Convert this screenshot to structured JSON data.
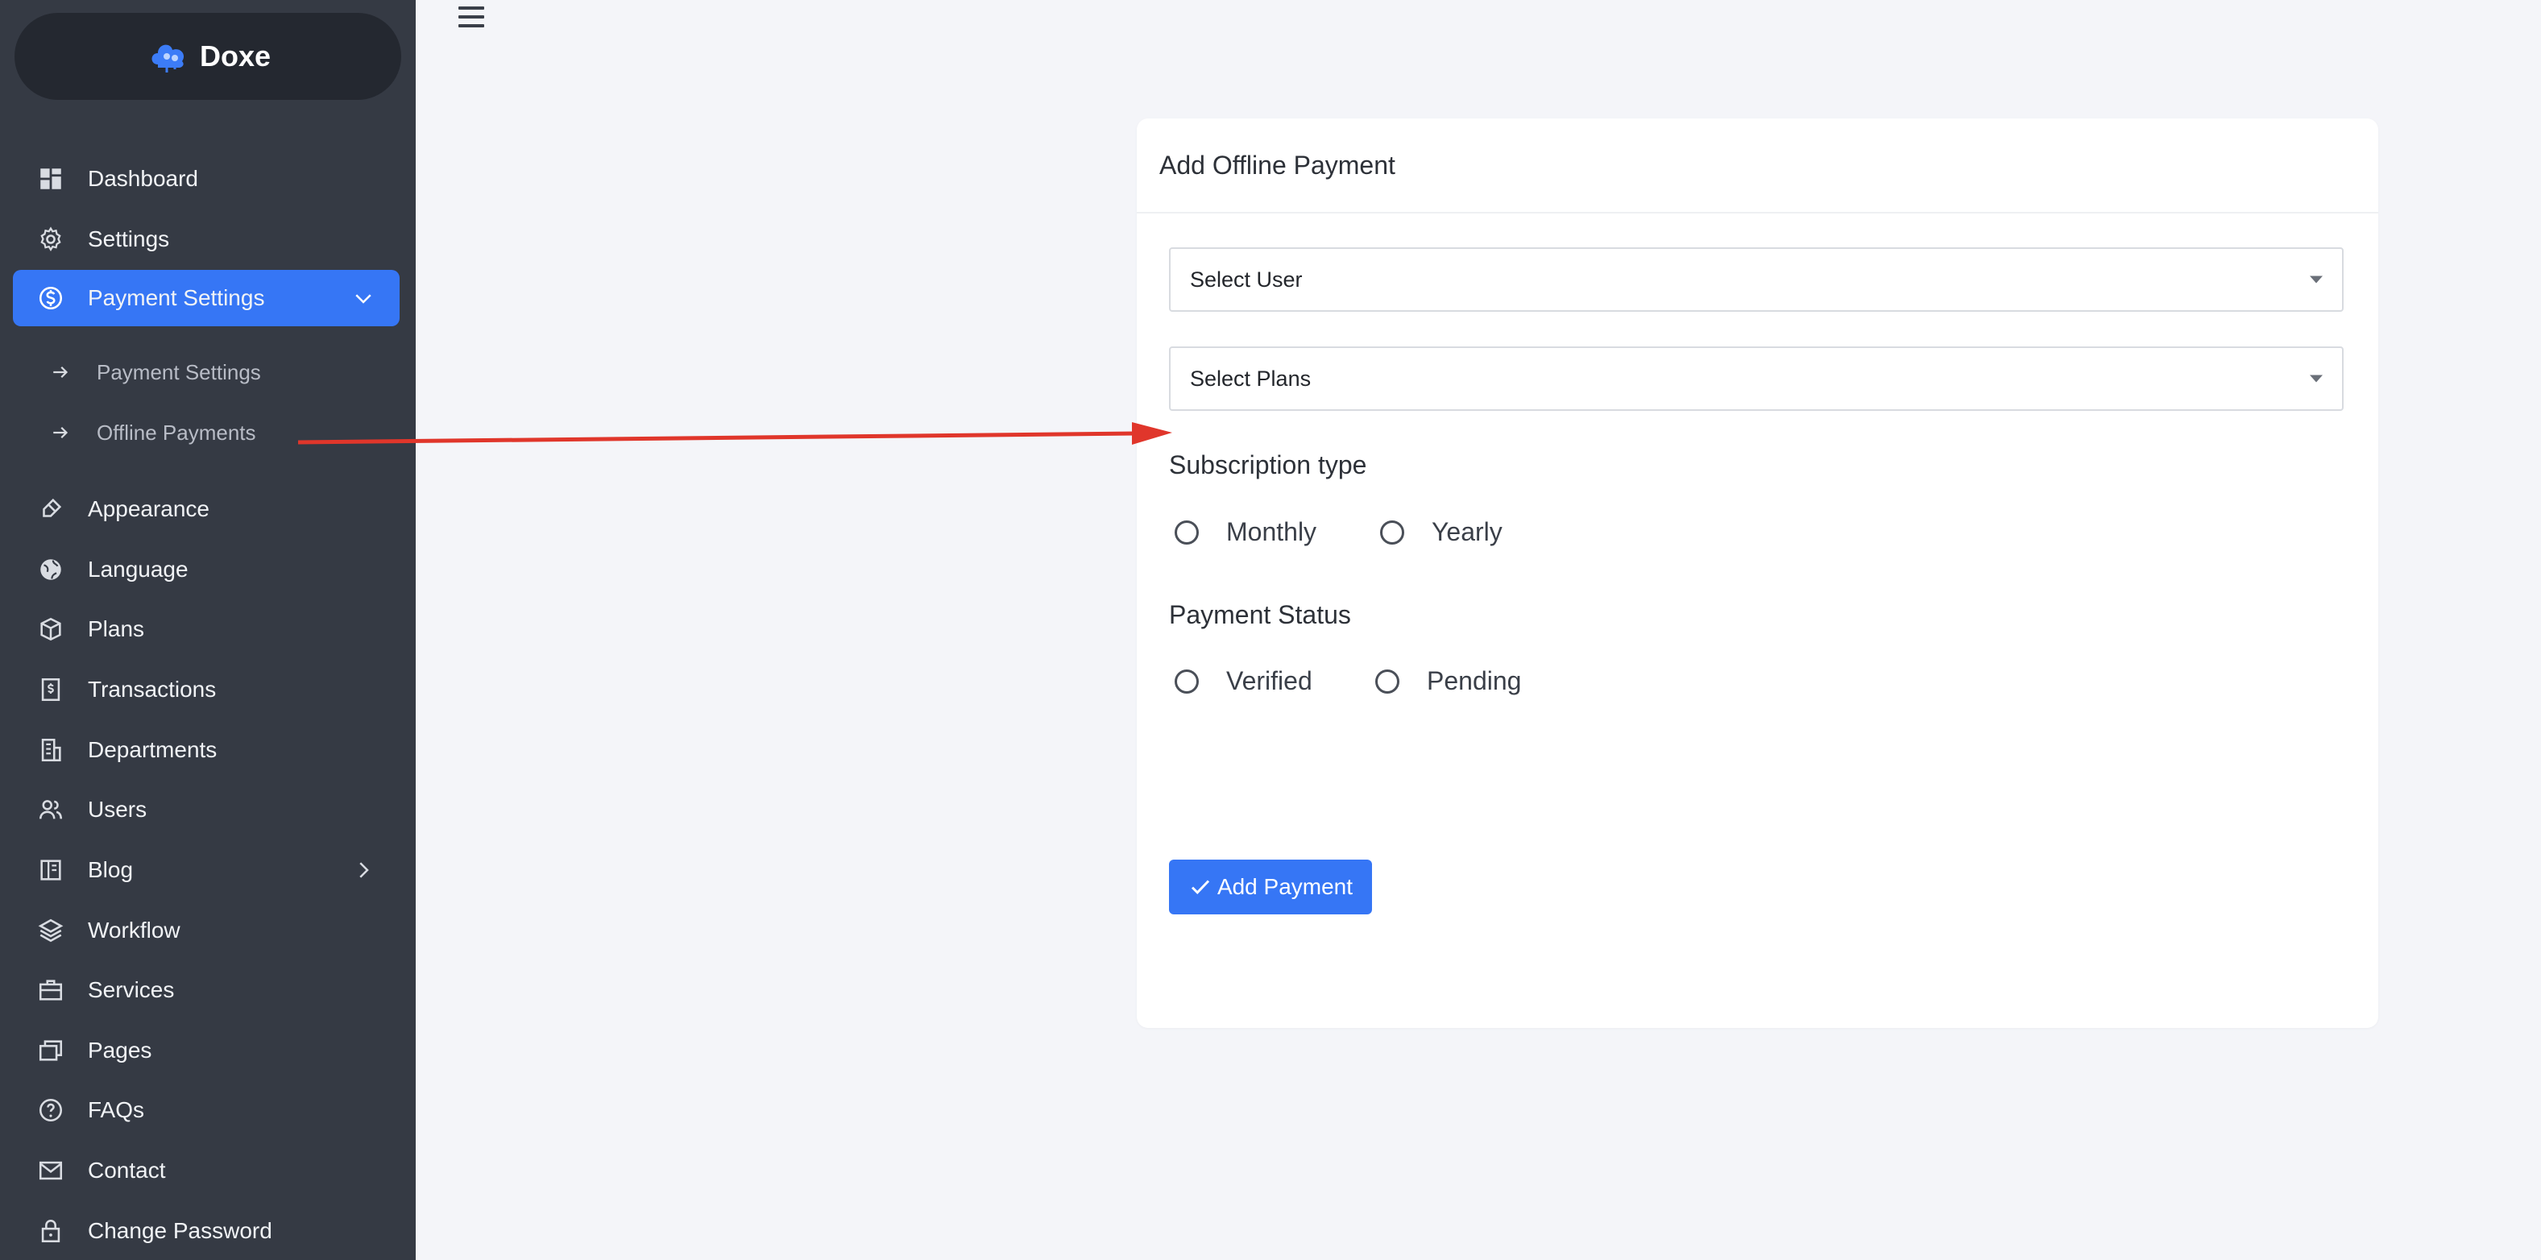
{
  "brand": {
    "name": "Doxe"
  },
  "sidebar": {
    "items": [
      {
        "label": "Dashboard",
        "icon": "dashboard-icon"
      },
      {
        "label": "Settings",
        "icon": "gear-icon"
      },
      {
        "label": "Payment Settings",
        "icon": "dollar-circle-icon",
        "active": true,
        "expanded": true
      },
      {
        "label": "Appearance",
        "icon": "brush-icon"
      },
      {
        "label": "Language",
        "icon": "globe-icon"
      },
      {
        "label": "Plans",
        "icon": "box-icon"
      },
      {
        "label": "Transactions",
        "icon": "receipt-icon"
      },
      {
        "label": "Departments",
        "icon": "building-icon"
      },
      {
        "label": "Users",
        "icon": "users-icon"
      },
      {
        "label": "Blog",
        "icon": "book-icon"
      },
      {
        "label": "Workflow",
        "icon": "layers-icon"
      },
      {
        "label": "Services",
        "icon": "briefcase-icon"
      },
      {
        "label": "Pages",
        "icon": "pages-icon"
      },
      {
        "label": "FAQs",
        "icon": "question-circle-icon"
      },
      {
        "label": "Contact",
        "icon": "mail-icon"
      },
      {
        "label": "Change Password",
        "icon": "lock-icon"
      }
    ],
    "sub_items": [
      {
        "label": "Payment Settings"
      },
      {
        "label": "Offline Payments"
      }
    ]
  },
  "card": {
    "title": "Add Offline Payment",
    "select_user": "Select User",
    "select_plans": "Select Plans",
    "subscription_label": "Subscription type",
    "subscription_options": [
      "Monthly",
      "Yearly"
    ],
    "status_label": "Payment Status",
    "status_options": [
      "Verified",
      "Pending"
    ],
    "submit_label": "Add Payment"
  },
  "colors": {
    "sidebar_bg": "#353a44",
    "accent": "#3676f5",
    "annotation": "#e0362b"
  }
}
